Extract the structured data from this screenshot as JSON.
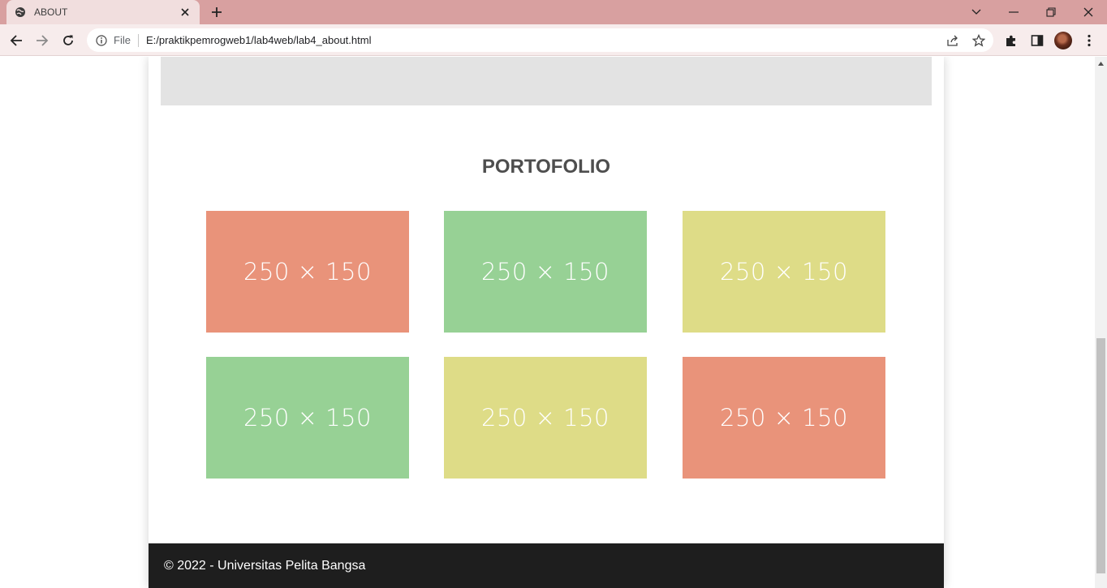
{
  "browser": {
    "tab_title": "ABOUT",
    "address_scheme_label": "File",
    "url": "E:/praktikpemrogweb1/lab4web/lab4_about.html"
  },
  "page": {
    "section_title": "PORTOFOLIO",
    "portfolio_items": [
      {
        "label": "250 × 150",
        "color": "#e9937a"
      },
      {
        "label": "250 × 150",
        "color": "#97d195"
      },
      {
        "label": "250 × 150",
        "color": "#dedc87"
      },
      {
        "label": "250 × 150",
        "color": "#97d195"
      },
      {
        "label": "250 × 150",
        "color": "#dedc87"
      },
      {
        "label": "250 × 150",
        "color": "#e9937a"
      }
    ],
    "footer_text": "© 2022 - Universitas Pelita Bangsa"
  },
  "colors": {
    "titlebar": "#d8a0a0",
    "footer_bg": "#1e1e1e",
    "gray_block": "#e3e3e3"
  }
}
